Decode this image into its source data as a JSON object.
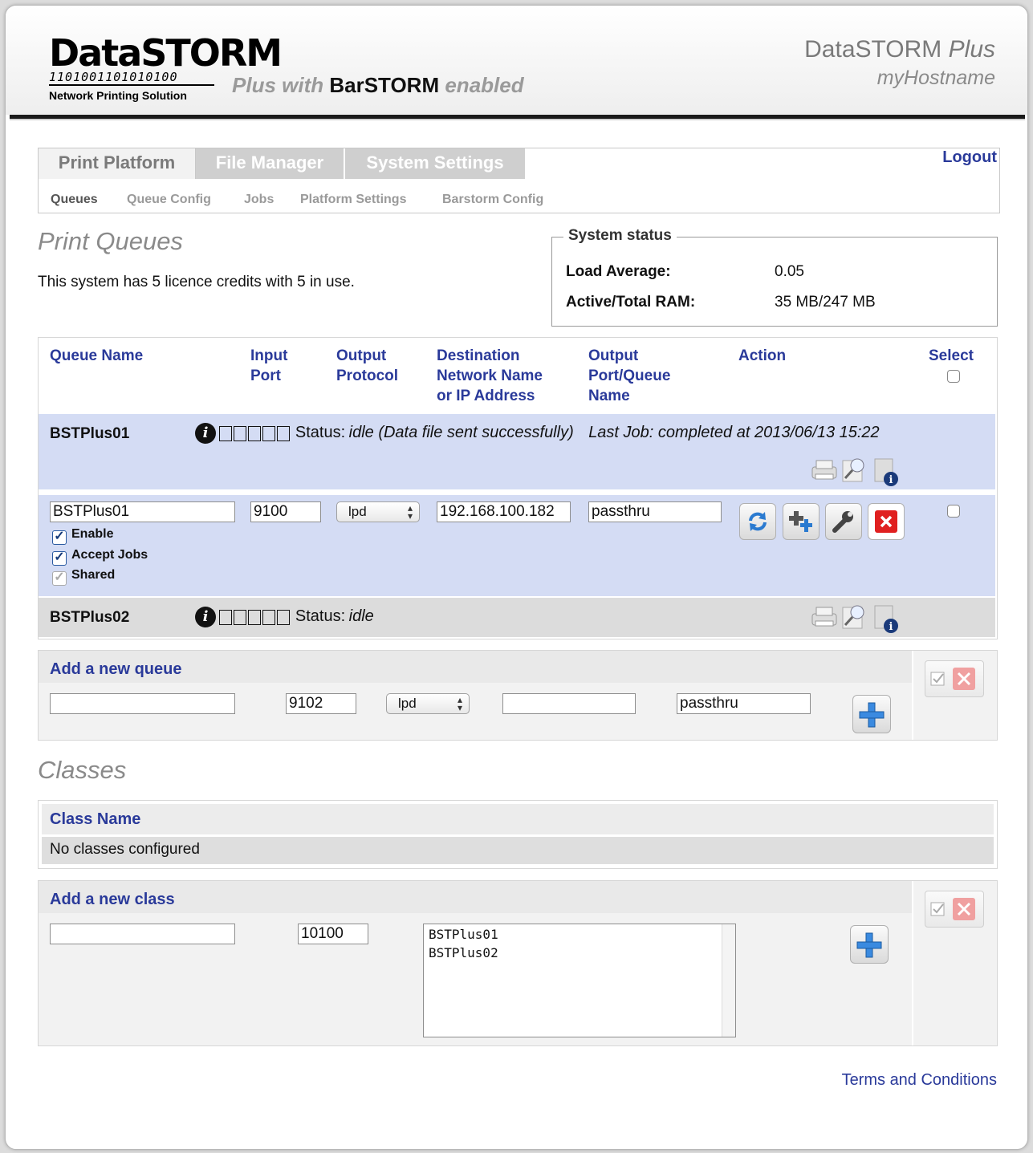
{
  "header": {
    "logo_title": "DataSTORM",
    "logo_binary": "1101001101010100",
    "logo_subtitle": "Network Printing Solution",
    "tagline_prefix": "Plus with ",
    "tagline_brand": "BarSTORM",
    "tagline_suffix": " enabled",
    "product_name": "DataSTORM",
    "product_edition": "Plus",
    "hostname": "myHostname"
  },
  "tabs": [
    {
      "label": "Print Platform",
      "active": true
    },
    {
      "label": "File Manager",
      "active": false
    },
    {
      "label": "System Settings",
      "active": false
    }
  ],
  "subtabs": [
    {
      "label": "Queues",
      "active": true
    },
    {
      "label": "Queue Config"
    },
    {
      "label": "Jobs"
    },
    {
      "label": "Platform Settings"
    },
    {
      "label": "Barstorm Config"
    }
  ],
  "logout_label": "Logout",
  "page_title": "Print Queues",
  "licence_text": "This system has 5 licence credits with 5 in use.",
  "system_status": {
    "legend": "System status",
    "load_label": "Load Average:",
    "load_value": "0.05",
    "ram_label": "Active/Total RAM:",
    "ram_value": "35 MB/247 MB"
  },
  "queue_table": {
    "headers": {
      "queue_name": "Queue Name",
      "input_port_1": "Input",
      "input_port_2": "Port",
      "output_protocol_1": "Output",
      "output_protocol_2": "Protocol",
      "destination_1": "Destination",
      "destination_2": "Network Name",
      "destination_3": "or IP Address",
      "output_port_1": "Output",
      "output_port_2": "Port/Queue",
      "output_port_3": "Name",
      "action": "Action",
      "select": "Select"
    },
    "queues": [
      {
        "name": "BSTPlus01",
        "status_label": "Status:",
        "status_value": "idle (Data file sent successfully)",
        "last_job": "Last Job: completed at 2013/06/13 15:22",
        "edit": {
          "name_value": "BSTPlus01",
          "input_port": "9100",
          "protocol": "lpd",
          "destination": "192.168.100.182",
          "output_queue": "passthru",
          "enable_label": "Enable",
          "accept_jobs_label": "Accept Jobs",
          "shared_label": "Shared"
        }
      },
      {
        "name": "BSTPlus02",
        "status_label": "Status:",
        "status_value": "idle"
      }
    ]
  },
  "add_queue": {
    "title": "Add a new queue",
    "name_value": "",
    "input_port": "9102",
    "protocol": "lpd",
    "destination": "",
    "output_queue": "passthru"
  },
  "classes_title": "Classes",
  "classes_table": {
    "header": "Class Name",
    "empty_text": "No classes configured"
  },
  "add_class": {
    "title": "Add a new class",
    "name_value": "",
    "port": "10100",
    "members": [
      "BSTPlus01",
      "BSTPlus02"
    ]
  },
  "terms_label": "Terms and Conditions",
  "colors": {
    "link_blue": "#2a3a9a",
    "row_selected": "#d4dcf4",
    "row_grey": "#dcdcdc",
    "delete_red": "#e02020"
  }
}
